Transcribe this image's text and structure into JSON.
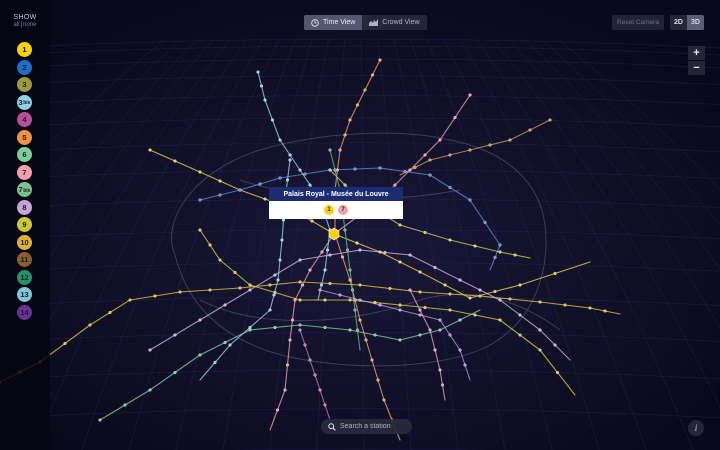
{
  "sidebar": {
    "show_label": "SHOW",
    "all_label": "all",
    "separator": "|",
    "none_label": "none",
    "lines": [
      {
        "num": "1",
        "suffix": "",
        "color": "#f5d20d"
      },
      {
        "num": "2",
        "suffix": "",
        "color": "#1f6cc9"
      },
      {
        "num": "3",
        "suffix": "",
        "color": "#9c9a3b"
      },
      {
        "num": "3",
        "suffix": "bis",
        "color": "#8fd3e8"
      },
      {
        "num": "4",
        "suffix": "",
        "color": "#b84d9a"
      },
      {
        "num": "5",
        "suffix": "",
        "color": "#f3914a"
      },
      {
        "num": "6",
        "suffix": "",
        "color": "#7fce9a"
      },
      {
        "num": "7",
        "suffix": "",
        "color": "#f1a0a8"
      },
      {
        "num": "7",
        "suffix": "bis",
        "color": "#7ac28a"
      },
      {
        "num": "8",
        "suffix": "",
        "color": "#c9a4d8"
      },
      {
        "num": "9",
        "suffix": "",
        "color": "#c8c83a"
      },
      {
        "num": "10",
        "suffix": "",
        "color": "#dcb23a"
      },
      {
        "num": "11",
        "suffix": "",
        "color": "#8b5e2f"
      },
      {
        "num": "12",
        "suffix": "",
        "color": "#23946a"
      },
      {
        "num": "13",
        "suffix": "",
        "color": "#7fc8d8"
      },
      {
        "num": "14",
        "suffix": "",
        "color": "#6a3399"
      }
    ]
  },
  "toolbar": {
    "time_view": "Time View",
    "crowd_view": "Crowd View",
    "reset_camera": "Reset Camera",
    "view_2d": "2D",
    "view_3d": "3D",
    "zoom_in": "+",
    "zoom_out": "−",
    "active_view": "Time View",
    "active_dimension": "3D"
  },
  "popup": {
    "station_name": "Palais Royal - Musée du Louvre",
    "lines": [
      {
        "num": "1",
        "color": "#f5d20d"
      },
      {
        "num": "7",
        "color": "#f1a0a8"
      }
    ]
  },
  "search": {
    "placeholder": "Search a station"
  },
  "info": {
    "label": "i"
  },
  "colors": {
    "background": "#0b0b22",
    "popup_header": "#1c2c73",
    "selected_station": "#f5d20d"
  }
}
